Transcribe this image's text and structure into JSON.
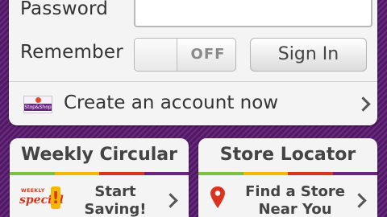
{
  "login": {
    "password_label": "Password",
    "password_value": "",
    "remember_label": "Remember",
    "remember_toggle": "OFF",
    "signin_label": "Sign In",
    "create_account_label": "Create an account now",
    "logo_text": "Stop&Shop"
  },
  "tiles": {
    "weekly": {
      "title": "Weekly Circular",
      "line1": "Start",
      "line2": "Saving!",
      "badge_small": "WEEKLY",
      "badge_word": "special"
    },
    "store": {
      "title": "Store Locator",
      "line1": "Find a Store",
      "line2": "Near You"
    }
  },
  "colors": {
    "background": "#5a1f6e",
    "accent_red": "#d9341f",
    "stripe": [
      "#7cc242",
      "#f5b800",
      "#d9341f",
      "#6b2384"
    ]
  },
  "icons": {
    "create_account_chevron": "chevron-right-icon",
    "weekly_chevron": "chevron-right-icon",
    "store_chevron": "chevron-right-icon",
    "store_pin": "map-pin-icon"
  }
}
